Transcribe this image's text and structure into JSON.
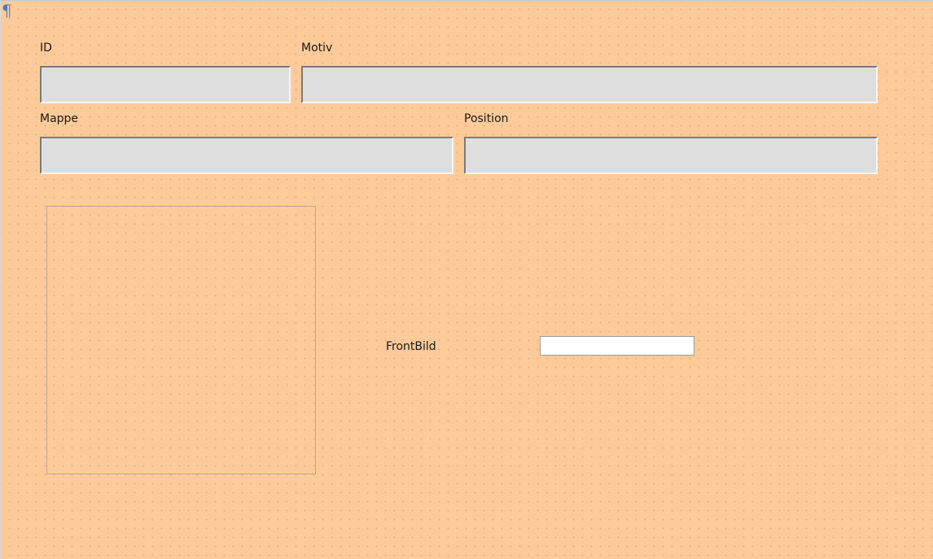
{
  "form": {
    "paragraph_mark": "¶",
    "fields": {
      "id": {
        "label": "ID",
        "value": ""
      },
      "motiv": {
        "label": "Motiv",
        "value": ""
      },
      "mappe": {
        "label": "Mappe",
        "value": ""
      },
      "position": {
        "label": "Position",
        "value": ""
      }
    },
    "front_bild": {
      "label": "FrontBild",
      "value": ""
    }
  },
  "colors": {
    "background": "#fdcb99",
    "field_background": "#dedede",
    "paragraph_mark": "#3d7fc1"
  },
  "icons": {
    "paragraph_mark": "pilcrow-icon"
  }
}
